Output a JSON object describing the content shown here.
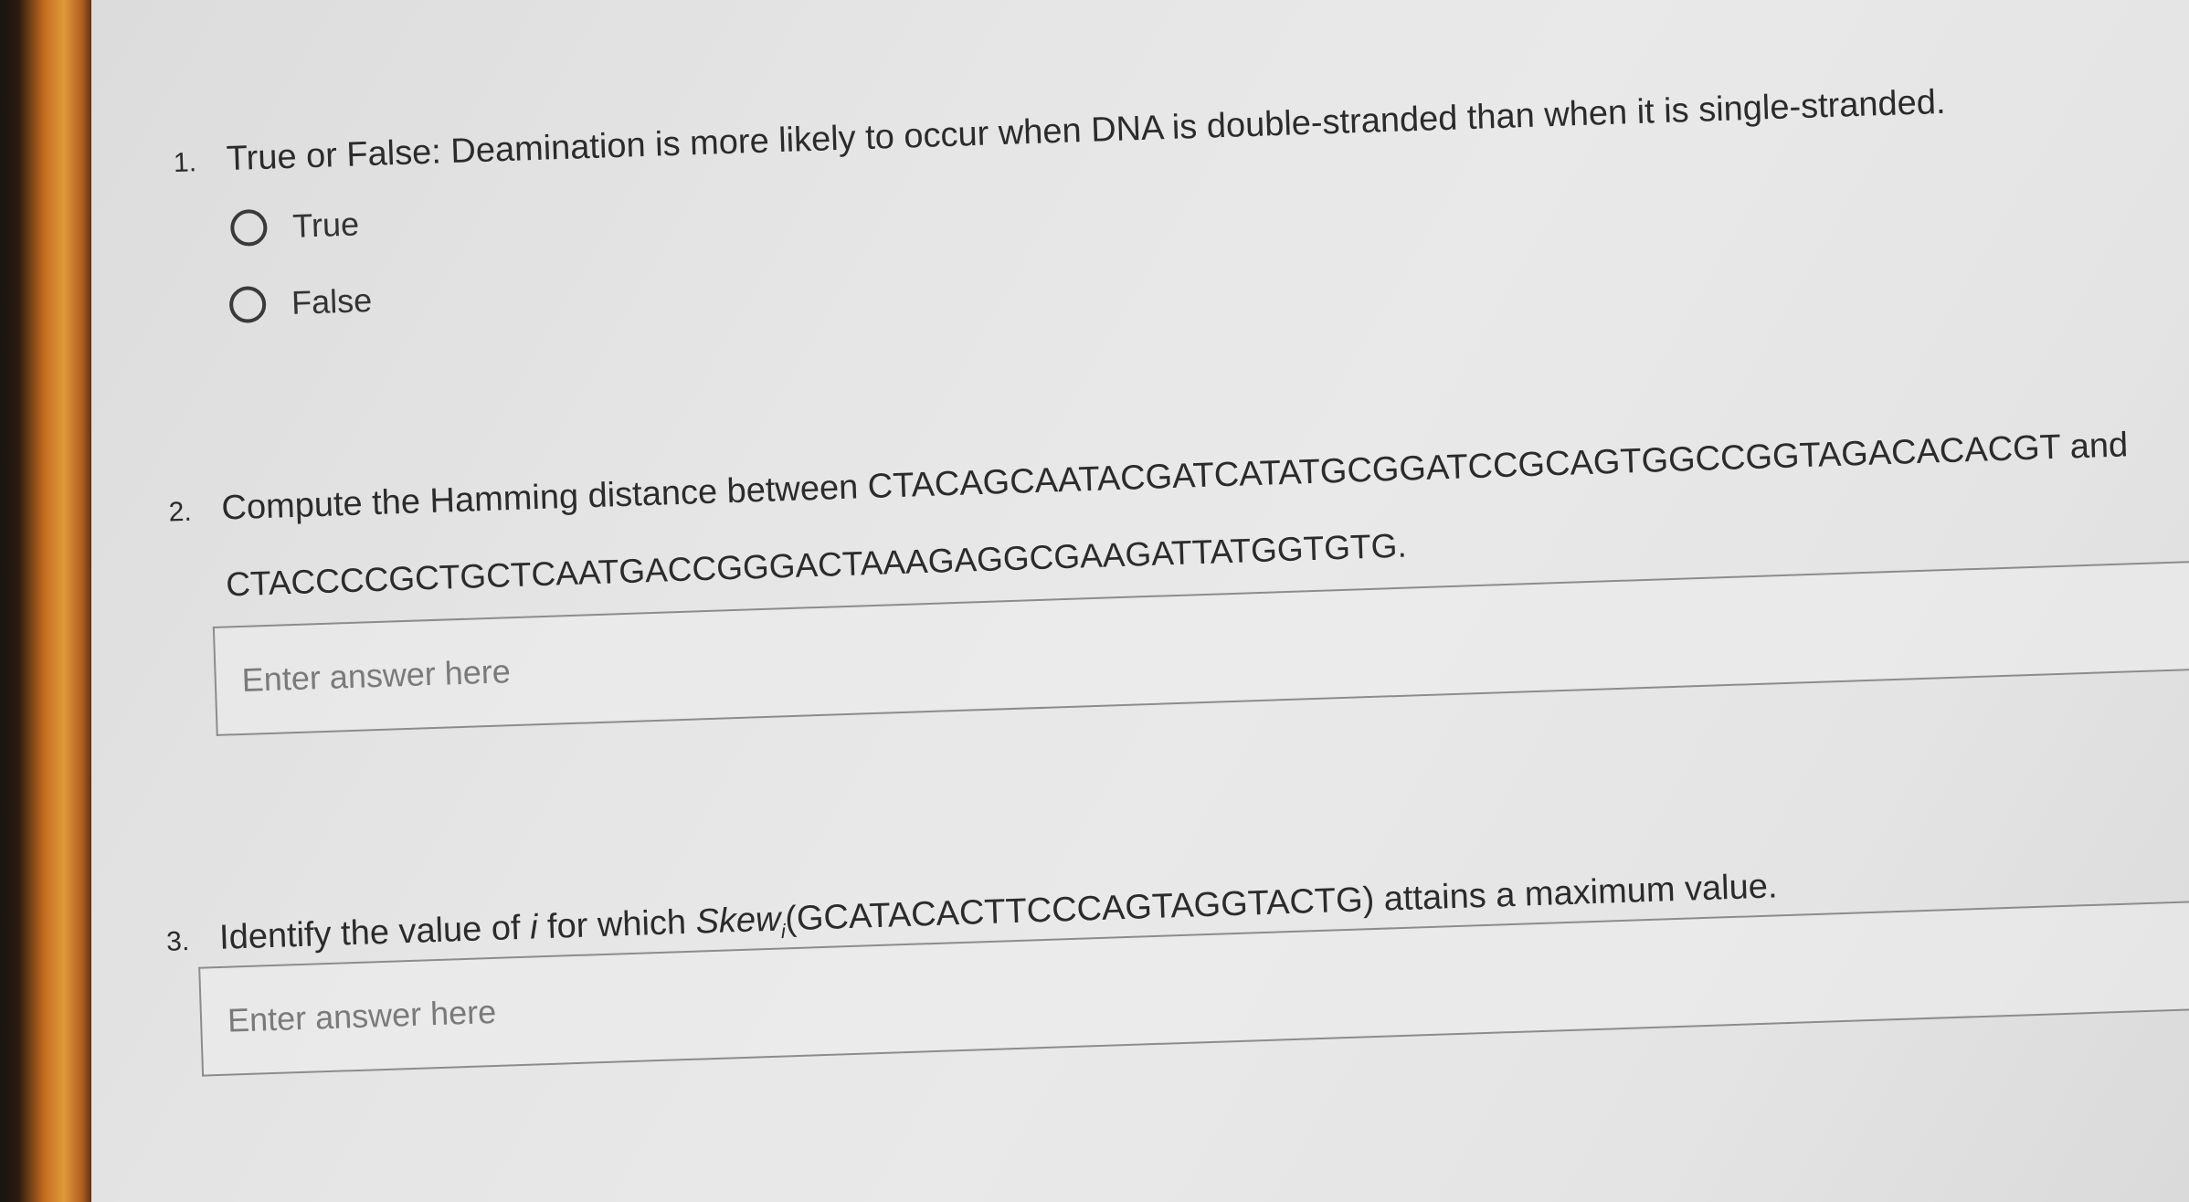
{
  "questions": {
    "q1": {
      "number": "1.",
      "text": "True or False: Deamination is more likely to occur when DNA is double-stranded than when it is single-stranded.",
      "options": [
        "True",
        "False"
      ]
    },
    "q2": {
      "number": "2.",
      "text": "Compute the Hamming distance between CTACAGCAATACGATCATATGCGGATCCGCAGTGGCCGGTAGACACACGT and",
      "sequence": "CTACCCCGCTGCTCAATGACCGGGACTAAAGAGGCGAAGATTATGGTGTG.",
      "placeholder": "Enter answer here"
    },
    "q3": {
      "number": "3.",
      "text_prefix": "Identify the value of ",
      "var_i": "i",
      "text_mid": " for which ",
      "skew": "Skew",
      "skew_sub": "i",
      "text_suffix": "(GCATACACTTCCCAGTAGGTACTG) attains a maximum value.",
      "placeholder": "Enter answer here"
    }
  }
}
